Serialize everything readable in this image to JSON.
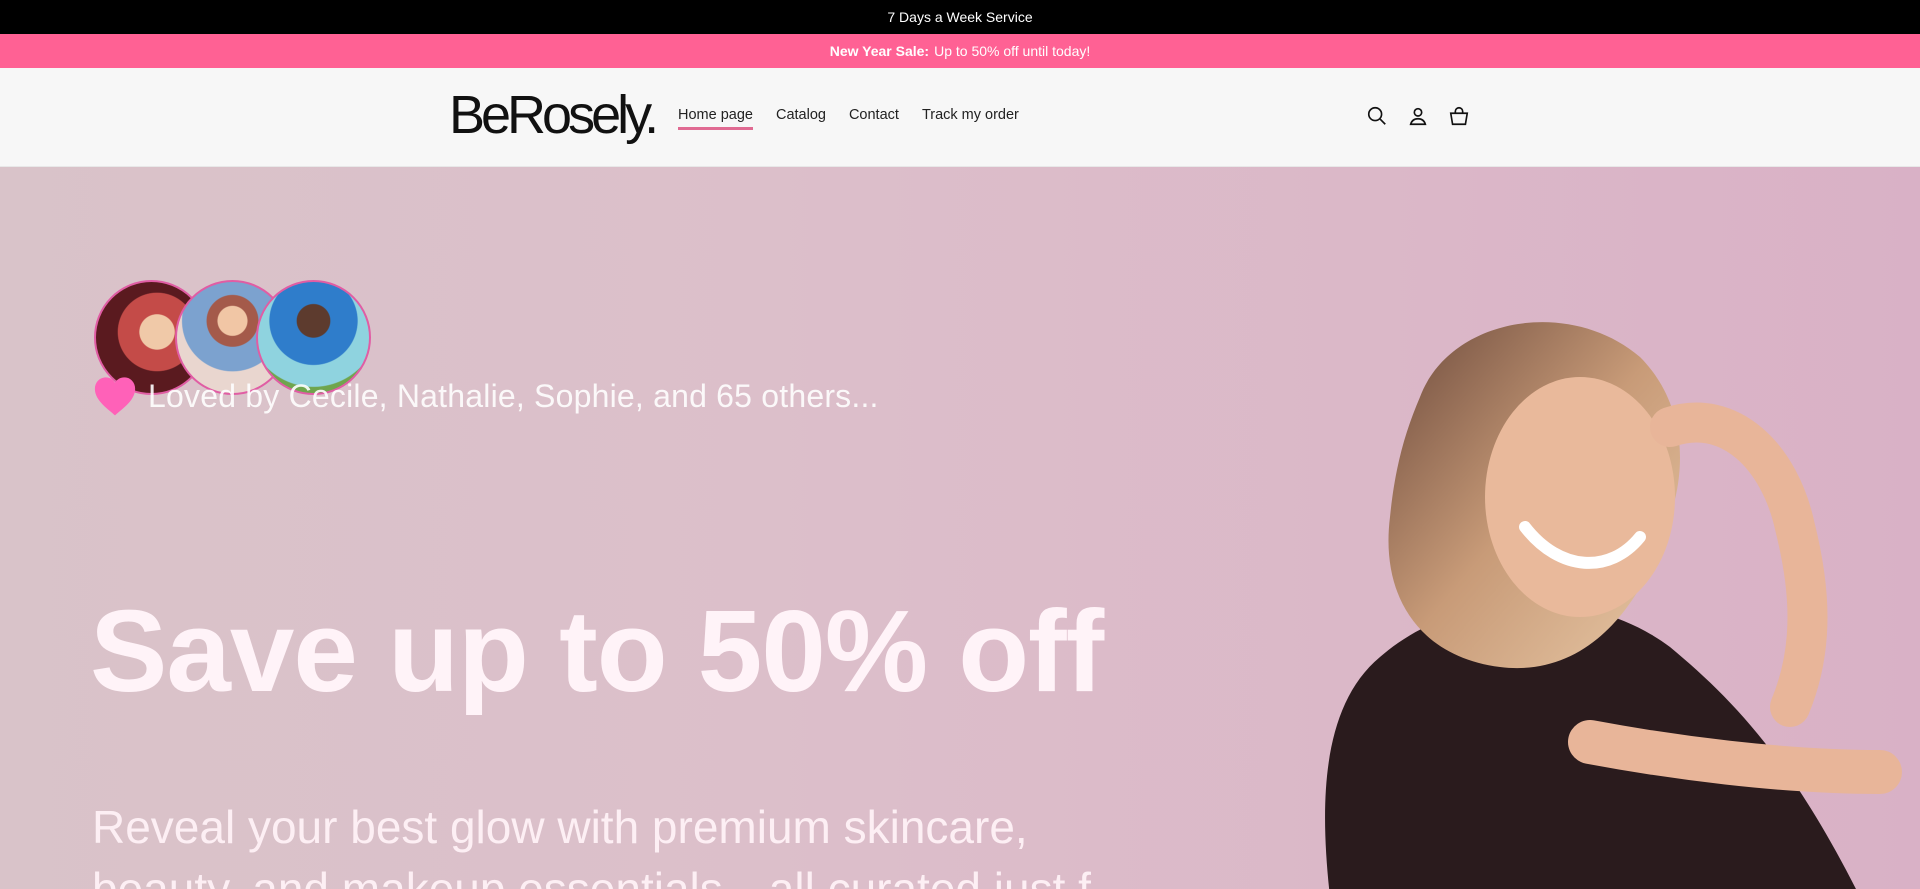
{
  "announcement": {
    "text": "7 Days a Week Service"
  },
  "sale_banner": {
    "strong": "New Year Sale:",
    "text": "Up to 50% off until today!"
  },
  "header": {
    "logo": "BeRosely.",
    "nav": [
      {
        "label": "Home page",
        "active": true
      },
      {
        "label": "Catalog",
        "active": false
      },
      {
        "label": "Contact",
        "active": false
      },
      {
        "label": "Track my order",
        "active": false
      }
    ],
    "icons": [
      "search-icon",
      "account-icon",
      "cart-icon"
    ]
  },
  "hero": {
    "loved_text": "Loved by Cecile, Nathalie, Sophie, and 65 others...",
    "headline": "Save up to 50% off",
    "subheadline": "Reveal your best glow with premium skincare, beauty, and makeup essentials—all curated just f"
  },
  "colors": {
    "accent": "#ff6194",
    "topbar": "#000000",
    "heart": "#ff61b8"
  }
}
